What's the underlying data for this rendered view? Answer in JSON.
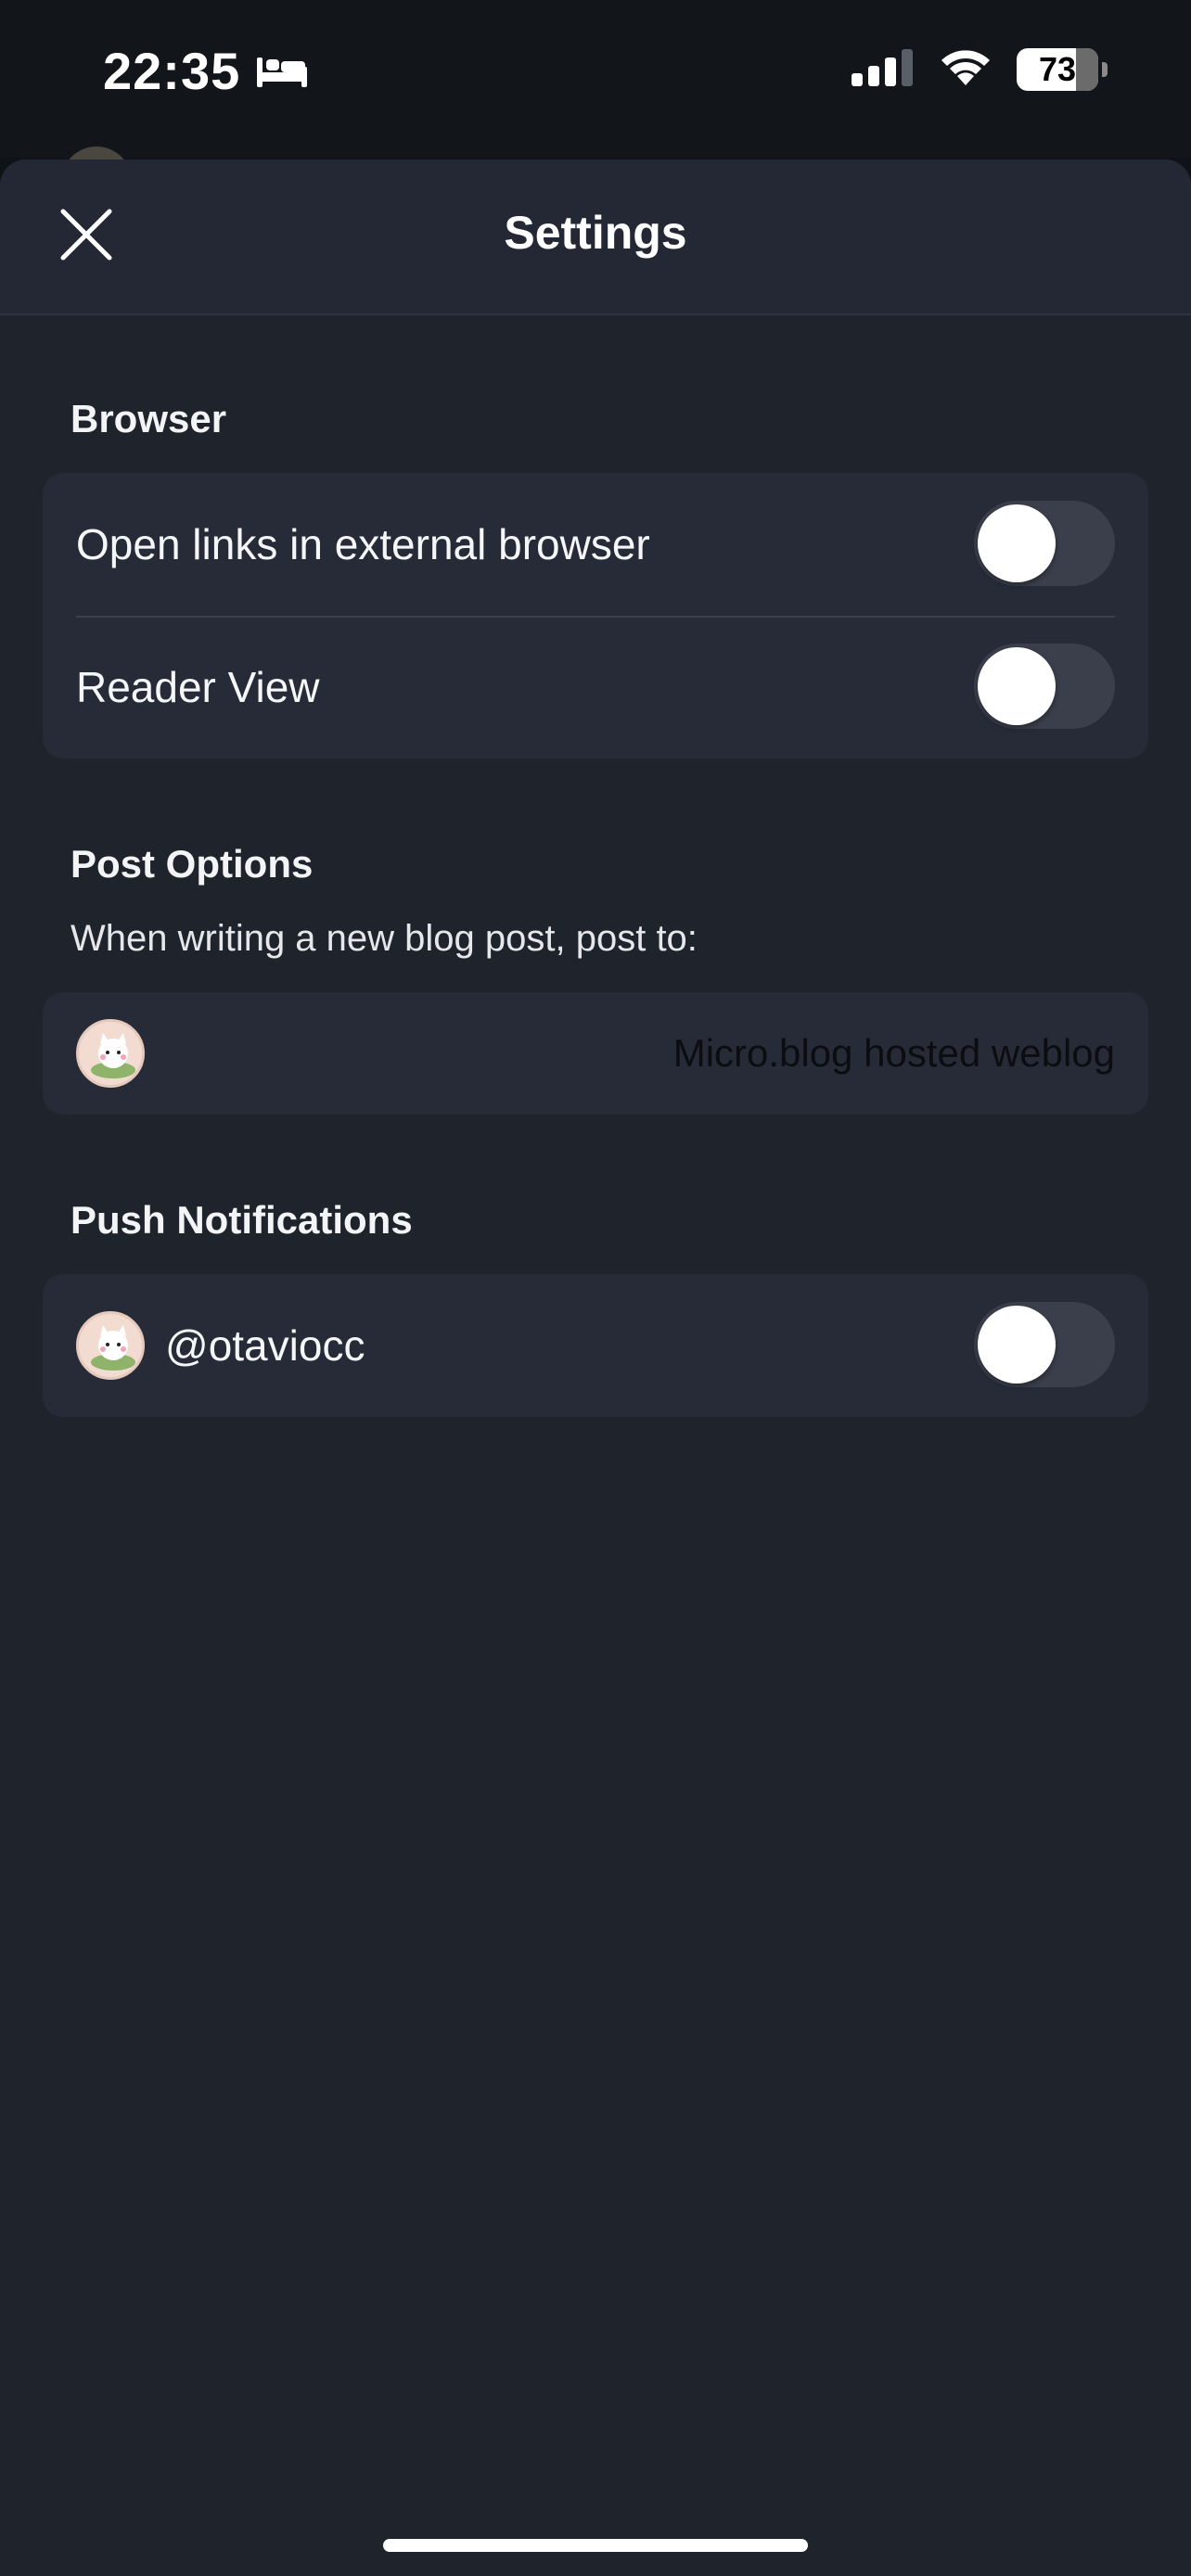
{
  "status_bar": {
    "time": "22:35",
    "battery_level": "73",
    "icons": [
      "bed-icon",
      "cellular-signal-icon",
      "wifi-icon",
      "battery-icon"
    ]
  },
  "sheet": {
    "title": "Settings",
    "close_icon": "close-icon"
  },
  "browser": {
    "section_title": "Browser",
    "items": [
      {
        "label": "Open links in external browser",
        "enabled": false
      },
      {
        "label": "Reader View",
        "enabled": false
      }
    ]
  },
  "post_options": {
    "section_title": "Post Options",
    "description": "When writing a new blog post, post to:",
    "selected_destination": "Micro.blog hosted weblog"
  },
  "push_notifications": {
    "section_title": "Push Notifications",
    "account": {
      "username": "@otaviocc",
      "enabled": false
    }
  },
  "colors": {
    "background": "#1f232c",
    "card": "#262b37",
    "toggle_off": "#3a3f4b"
  }
}
